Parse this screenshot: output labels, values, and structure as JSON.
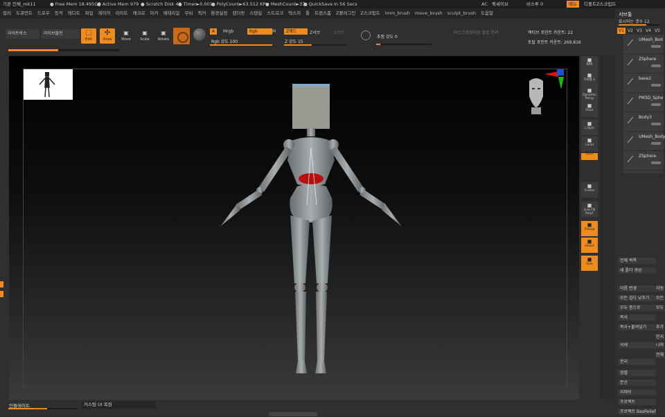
{
  "titlebar": {
    "app": "기본 인체_mk11",
    "free_mem": "● Free Mem 18.495GB",
    "active_mem": "● Active Mem 979",
    "scratch": "● Scratch Disk 49",
    "timer": "● Timer►0.001",
    "polycount": "● PolyCount►63.512 KP",
    "meshcount": "● MeshCount►37",
    "quicksave": "● QuickSave In 56 Secs",
    "ac": "AC",
    "recipe": "퀵세이브",
    "perspective": "비스투 0",
    "menu": "메뉴",
    "default_script": "디폴트Z스크립트"
  },
  "menubar": [
    "컬러",
    "도큐먼트",
    "드로우",
    "동적",
    "에디트",
    "파일",
    "레이어",
    "라이트",
    "매크로",
    "마커",
    "메테리얼",
    "무비",
    "픽커",
    "환경설정",
    "렌더링",
    "스텐실",
    "스트로크",
    "텍스처",
    "툴",
    "트랜스폼",
    "Z플러그인",
    "Z스크립트",
    "imm_brush",
    "move_brush",
    "sculpt_brush",
    "도움말"
  ],
  "toolbar": {
    "lightbox": "라이트박스",
    "live_boolean": "라이브불린",
    "edit": "Edit",
    "draw": "Draw",
    "move": "Move",
    "scale": "Scale",
    "rotate": "Rotate",
    "a": "A",
    "mrgb": "Mrgb",
    "rgb": "Rgb",
    "m": "M",
    "zadd": "Z애드",
    "zsub": "Z서브",
    "zcut": "Z커트",
    "rgb_intensity": "Rgb 강도 100",
    "z_intensity": "Z 강도 15",
    "focal_shift": "초점 강도 0",
    "mask_label": "마스크경화이된 벌로 분리",
    "active_points": "액티브 포인트 카운트: 22",
    "total_points": "토탈 포인트 카운트: 269,816",
    "progress": 0.45
  },
  "shelf": [
    "BPR",
    "S픽셀 3",
    "Dynamic Persp",
    "Floor",
    "L.Sym",
    "Local",
    "Qxyz",
    "Frame",
    "Line Fill PolyF",
    "Transp",
    "Ghost",
    "Solo"
  ],
  "subtool_panel": {
    "title": "서브툴",
    "visible_count": "표시되는 갯수 12",
    "tabs": [
      "V1",
      "V2",
      "V3",
      "V4",
      "V5"
    ],
    "items": [
      "UMesh_Bod",
      "ZSphere",
      "base2",
      "PM3D_Sphe",
      "Body3",
      "UMesh_Body",
      "ZSphere"
    ],
    "actions": [
      "전체 목록",
      "새 폴더 생성",
      "이름 변경",
      "모든 섭다 낮추기",
      "모두 종으로",
      "복사",
      "복사+붙여넣기",
      "삭제",
      "분리",
      "정렬",
      "분산",
      "리메쉬",
      "프로젝트",
      "프로젝트 BasRelief"
    ],
    "side_actions": [
      "자동",
      "모든",
      "모두",
      "추가",
      "인서",
      "나머",
      "전체"
    ]
  },
  "bottombar": {
    "brush": "인플레이트",
    "menu_restore": "커스텀 UI 복원"
  }
}
